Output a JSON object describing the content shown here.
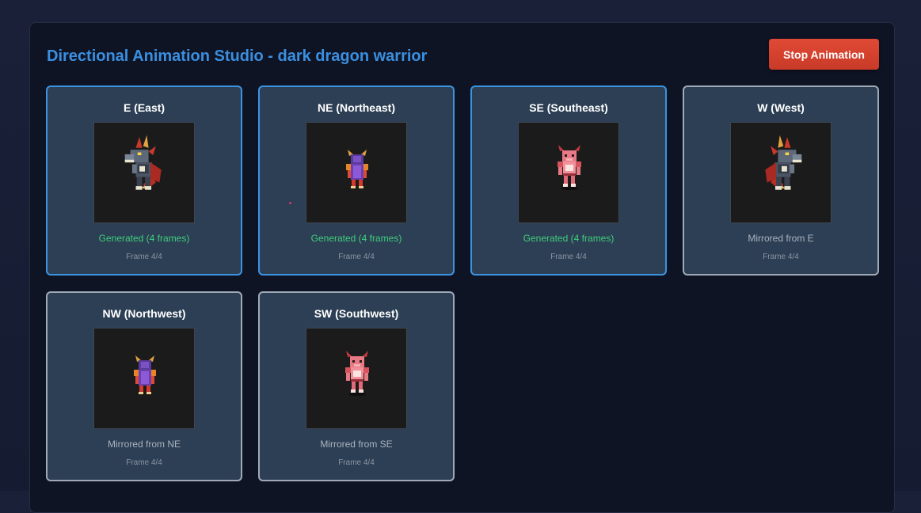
{
  "studio": {
    "title": "Directional Animation Studio - dark dragon warrior",
    "stop_button": "Stop Animation"
  },
  "directions": [
    {
      "label": "E (East)",
      "status": "Generated (4 frames)",
      "frame": "Frame 4/4",
      "state": "generated",
      "sprite": "dragon-side-icon",
      "facing": "right"
    },
    {
      "label": "NE (Northeast)",
      "status": "Generated (4 frames)",
      "frame": "Frame 4/4",
      "state": "generated",
      "sprite": "warrior-back-icon",
      "facing": "right"
    },
    {
      "label": "SE (Southeast)",
      "status": "Generated (4 frames)",
      "frame": "Frame 4/4",
      "state": "generated",
      "sprite": "warrior-front-icon",
      "facing": "right"
    },
    {
      "label": "W (West)",
      "status": "Mirrored from E",
      "frame": "Frame 4/4",
      "state": "mirrored",
      "sprite": "dragon-side-icon",
      "facing": "left"
    },
    {
      "label": "NW (Northwest)",
      "status": "Mirrored from NE",
      "frame": "Frame 4/4",
      "state": "mirrored",
      "sprite": "warrior-back-icon",
      "facing": "left"
    },
    {
      "label": "SW (Southwest)",
      "status": "Mirrored from SE",
      "frame": "Frame 4/4",
      "state": "mirrored",
      "sprite": "warrior-front-icon",
      "facing": "left"
    }
  ],
  "colors": {
    "title": "#3a8fe0",
    "generated_text": "#3ecf7a",
    "active_border": "#3a94e2",
    "mirrored_border": "#a0aab6",
    "stop_button": "#d9412e"
  }
}
